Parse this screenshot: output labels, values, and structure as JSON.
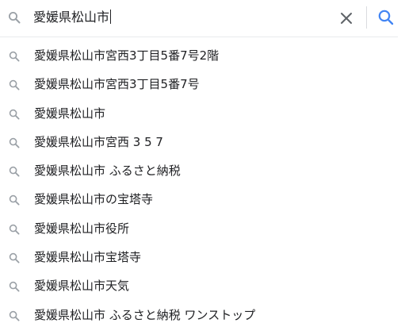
{
  "search": {
    "value": "愛媛県松山市",
    "search_icon": "search-icon",
    "clear_icon": "close-icon"
  },
  "colors": {
    "text": "#202124",
    "icon": "#9aa0a6",
    "divider": "#dadce0"
  },
  "suggestions": [
    "愛媛県松山市宮西3丁目5番7号2階",
    "愛媛県松山市宮西3丁目5番7号",
    "愛媛県松山市",
    "愛媛県松山市宮西 3 5 7",
    "愛媛県松山市 ふるさと納税",
    "愛媛県松山市の宝塔寺",
    "愛媛県松山市役所",
    "愛媛県松山市宝塔寺",
    "愛媛県松山市天気",
    "愛媛県松山市 ふるさと納税 ワンストップ"
  ]
}
